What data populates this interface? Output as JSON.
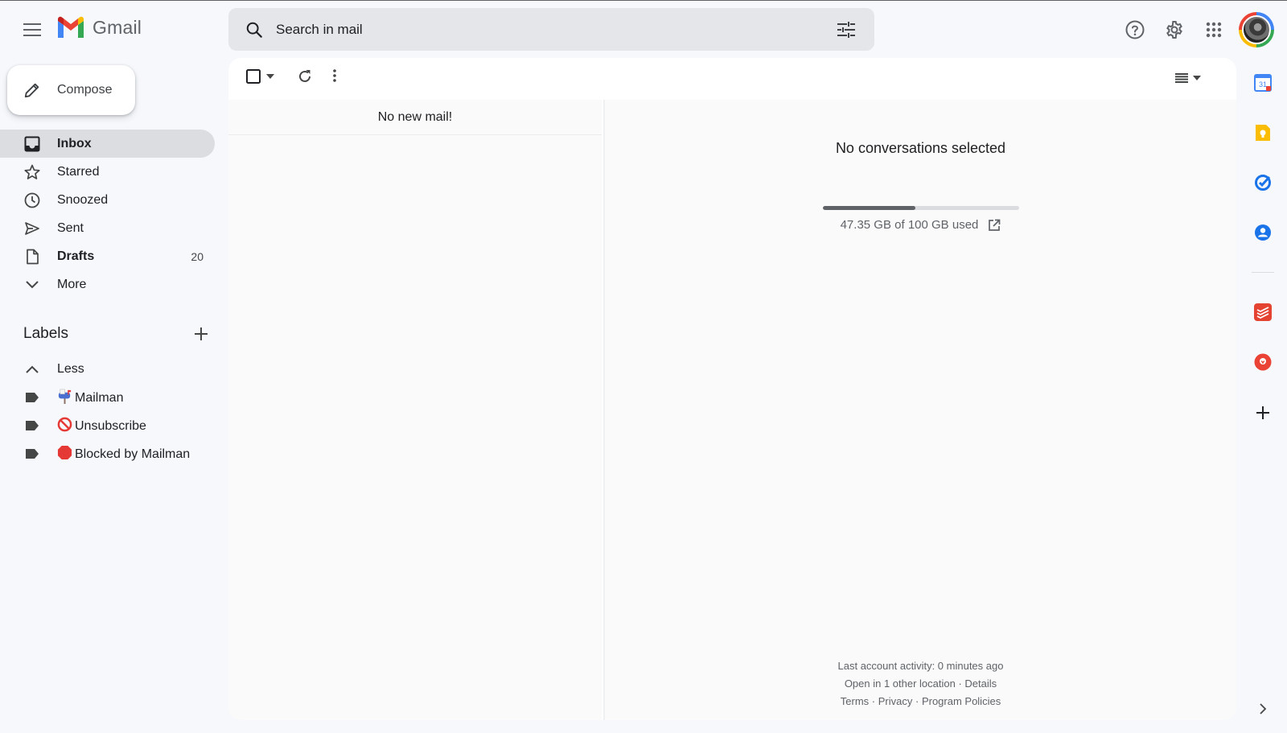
{
  "app": {
    "name": "Gmail"
  },
  "search": {
    "placeholder": "Search in mail"
  },
  "compose": {
    "label": "Compose"
  },
  "nav": {
    "items": [
      {
        "label": "Inbox",
        "count": ""
      },
      {
        "label": "Starred",
        "count": ""
      },
      {
        "label": "Snoozed",
        "count": ""
      },
      {
        "label": "Sent",
        "count": ""
      },
      {
        "label": "Drafts",
        "count": "20"
      },
      {
        "label": "More",
        "count": ""
      }
    ]
  },
  "labels": {
    "title": "Labels",
    "toggle": "Less",
    "items": [
      {
        "emoji": "mailbox",
        "label": "Mailman"
      },
      {
        "emoji": "prohibited",
        "label": "Unsubscribe"
      },
      {
        "emoji": "stop-sign",
        "label": "Blocked by Mailman"
      }
    ]
  },
  "list": {
    "empty_text": "No new mail!"
  },
  "reading": {
    "empty_text": "No conversations selected",
    "storage": {
      "used_text": "47.35 GB of 100 GB used",
      "fraction": 0.4735
    }
  },
  "footer": {
    "activity": "Last account activity: 0 minutes ago",
    "location": "Open in 1 other location",
    "details": "Details",
    "terms": "Terms",
    "privacy": "Privacy",
    "policies": "Program Policies",
    "sep": " · "
  },
  "side_panel": {
    "calendar_day": "31",
    "icons": [
      "calendar-icon",
      "keep-icon",
      "tasks-icon",
      "contacts-icon",
      "todoist-icon",
      "hubspot-icon",
      "add-addon-icon"
    ]
  },
  "colors": {
    "background": "#f6f8fc",
    "active_nav": "#dcdde0",
    "gmail_red": "#ea4335",
    "gmail_blue": "#4285f4",
    "gmail_green": "#34a853",
    "gmail_yellow": "#fbbc04"
  }
}
